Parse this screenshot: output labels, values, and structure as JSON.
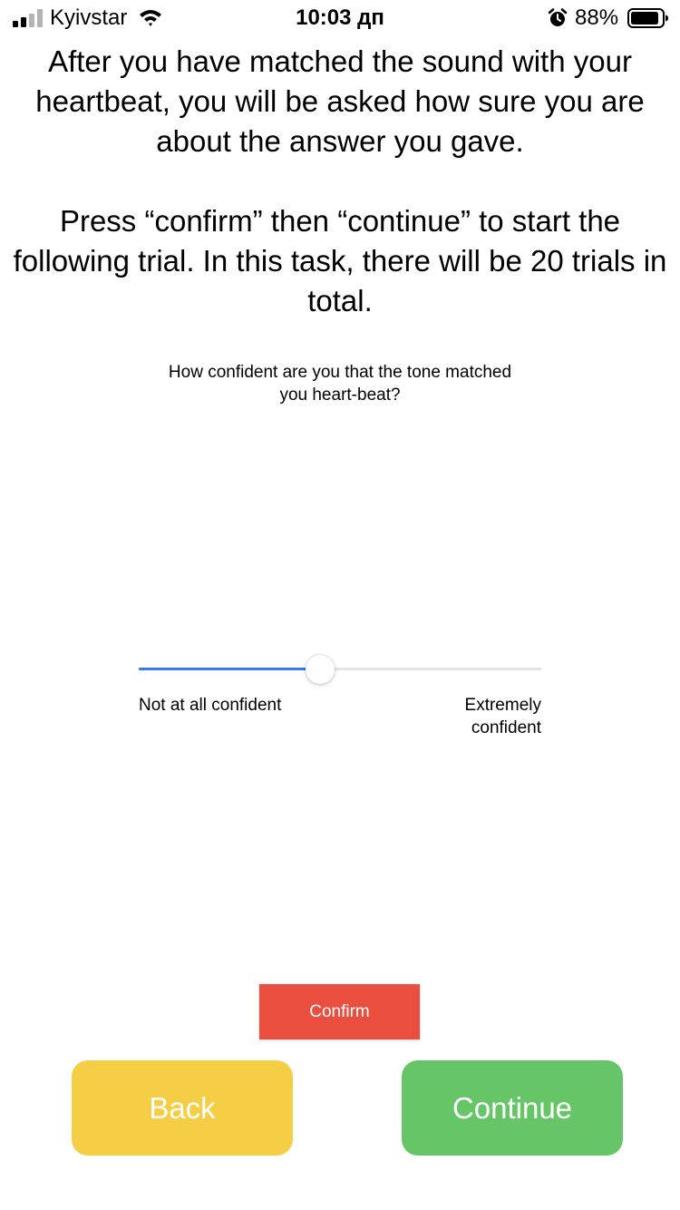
{
  "status_bar": {
    "carrier": "Kyivstar",
    "time": "10:03 дп",
    "battery_percent": "88%",
    "signal_bars_filled": 2,
    "signal_bars_total": 4,
    "battery_level": 0.88,
    "icons": [
      "signal-icon",
      "wifi-icon",
      "alarm-icon",
      "battery-icon"
    ]
  },
  "instructions": {
    "paragraph_1": "After you have matched the sound with your heartbeat, you will be asked how sure you are about the answer you gave.",
    "paragraph_2": "Press “confirm” then “continue” to start the following trial. In this task, there will be 20 trials in total."
  },
  "question": "How confident are you that the tone matched you heart-beat?",
  "slider": {
    "value": 0.45,
    "min_label": "Not at all confident",
    "max_label": "Extremely confident",
    "accent_color": "#3478f6"
  },
  "buttons": {
    "confirm_label": "Confirm",
    "back_label": "Back",
    "continue_label": "Continue",
    "confirm_color": "#e94e3f",
    "back_color": "#f6ce46",
    "continue_color": "#66c667"
  }
}
